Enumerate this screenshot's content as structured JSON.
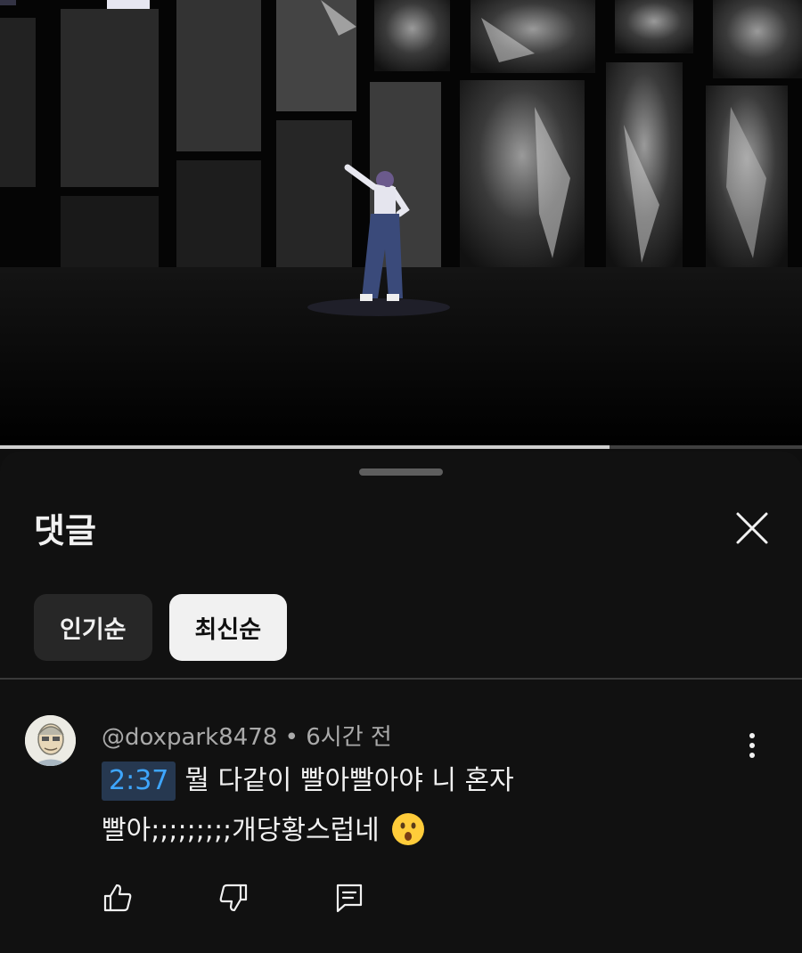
{
  "video": {
    "progress_fraction": 0.76
  },
  "comments_panel": {
    "title": "댓글",
    "close_icon": "close-icon",
    "sort_chips": [
      {
        "label": "인기순",
        "selected": false
      },
      {
        "label": "최신순",
        "selected": true
      }
    ],
    "comment": {
      "author": "@doxpark8478",
      "separator": "•",
      "time": "6시간 전",
      "timestamp_link": "2:37",
      "text_part1": "뭘 다같이 빨아빨아야 니 혼자",
      "text_part2": "빨아;;;;;;;;;개당황스럽네",
      "emoji": "hushed-face-emoji",
      "actions": {
        "like_icon": "thumbs-up-icon",
        "dislike_icon": "thumbs-down-icon",
        "reply_icon": "reply-comment-icon"
      }
    }
  },
  "colors": {
    "background": "#0f0f0f",
    "timestamp_link": "#3ea6ff",
    "chip_active": "#f1f1f1",
    "chip_inactive": "#272727"
  }
}
